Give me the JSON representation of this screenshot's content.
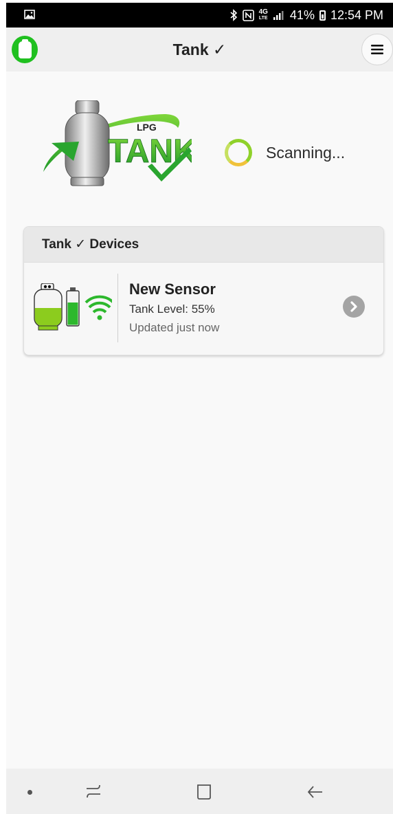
{
  "status_bar": {
    "network_small": "4G",
    "network_sub": "LTE",
    "battery": "41%",
    "time": "12:54 PM",
    "icons": [
      "gallery-icon",
      "bluetooth-icon",
      "nfc-icon",
      "signal-icon",
      "battery-icon"
    ]
  },
  "app_bar": {
    "title": "Tank ✓",
    "logo_icon": "gas-tank-icon",
    "menu_icon": "hamburger-menu-icon"
  },
  "brand": {
    "logo_small": "LPG",
    "logo_large": "TANK"
  },
  "scan": {
    "text": "Scanning..."
  },
  "devices": {
    "header": "Tank ✓ Devices",
    "items": [
      {
        "name": "New Sensor",
        "level_text": "Tank Level: 55%",
        "level_fraction": 0.55,
        "updated": "Updated just now"
      }
    ]
  },
  "colors": {
    "brand_green": "#2db82d",
    "accent_lime": "#8fd12a",
    "scan_yellow": "#f0c23a",
    "card_header": "#e8e8e8",
    "chevron": "#a4a4a4"
  },
  "nav_bar": {
    "icons": [
      "nav-dot-icon",
      "recents-icon",
      "home-icon",
      "back-icon"
    ]
  }
}
